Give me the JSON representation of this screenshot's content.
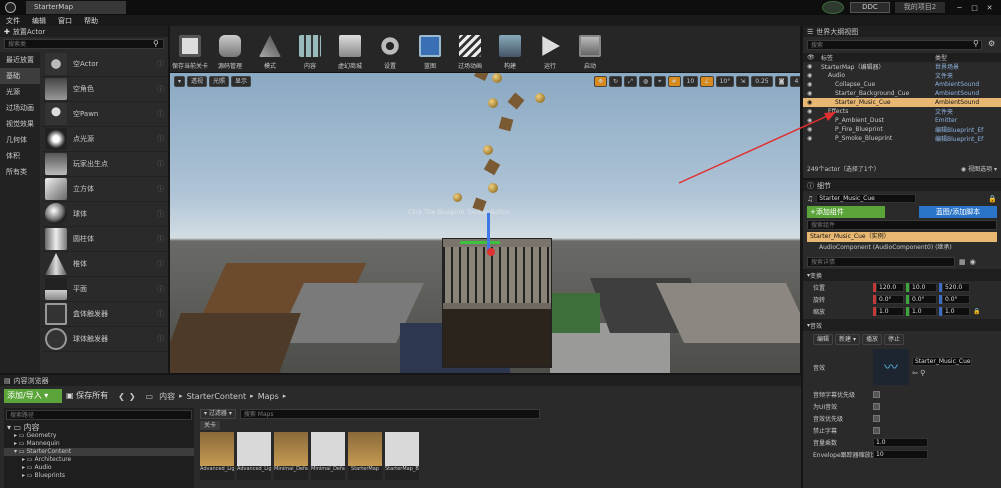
{
  "window": {
    "tab_title": "StarterMap",
    "ddc_label": "DDC",
    "project_name": "我的项目2"
  },
  "menu": [
    "文件",
    "编辑",
    "窗口",
    "帮助"
  ],
  "place_panel": {
    "title": "放置Actor",
    "search_placeholder": "搜索类",
    "categories": [
      "最近放置",
      "基础",
      "光源",
      "过场动画",
      "视觉效果",
      "几何体",
      "体积",
      "所有类"
    ],
    "selected_category": "基础",
    "items": [
      "空Actor",
      "空角色",
      "空Pawn",
      "点光源",
      "玩家出生点",
      "立方体",
      "球体",
      "圆柱体",
      "椎体",
      "平面",
      "盒体触发器",
      "球体触发器"
    ]
  },
  "toolbar": {
    "buttons": [
      "保存当前关卡",
      "源码管理",
      "模式",
      "内容",
      "虚幻商城",
      "设置",
      "蓝图",
      "过场动画",
      "构建",
      "运行",
      "启动"
    ]
  },
  "viewport": {
    "left_buttons": [
      "透视",
      "光照",
      "显示"
    ],
    "grid_snap": "10",
    "rotation_snap": "10°",
    "scale_snap": "0.25",
    "camera_speed": "4",
    "watermark": "Click The Blueprint Toolbar Button"
  },
  "outliner": {
    "title": "世界大纲视图",
    "search_placeholder": "搜索",
    "col_label": "标签",
    "col_type": "类型",
    "rows": [
      {
        "label": "StarterMap（编辑器）",
        "type": "世界场景",
        "indent": 0
      },
      {
        "label": "Audio",
        "type": "文件夹",
        "indent": 1
      },
      {
        "label": "Collapse_Cue",
        "type": "AmbientSound",
        "indent": 2
      },
      {
        "label": "Starter_Background_Cue",
        "type": "AmbientSound",
        "indent": 2
      },
      {
        "label": "Starter_Music_Cue",
        "type": "AmbientSound",
        "indent": 2
      },
      {
        "label": "Effects",
        "type": "文件夹",
        "indent": 1
      },
      {
        "label": "P_Ambient_Dust",
        "type": "Emitter",
        "indent": 2
      },
      {
        "label": "P_Fire_Blueprint",
        "type": "编辑Blueprint_Ef",
        "indent": 2
      },
      {
        "label": "P_Smoke_Blueprint",
        "type": "编辑Blueprint_Ef",
        "indent": 2
      }
    ],
    "selected_row": 4,
    "footer_count": "249个actor（选择了1个）",
    "view_options": "视图选项"
  },
  "details": {
    "title": "细节",
    "name_value": "Starter_Music_Cue",
    "add_component": "+添加组件",
    "blueprint_button": "蓝图/添加脚本",
    "component_search": "搜索组件",
    "root_component": "Starter_Music_Cue（实例）",
    "child_component": "AudioComponent (AudioComponent0) (继承)",
    "detail_search": "搜索详情",
    "transform_section": "变换",
    "location_label": "位置",
    "location": [
      "120.0",
      "10.0",
      "520.0"
    ],
    "rotation_label": "旋转",
    "rotation": [
      "0.0°",
      "0.0°",
      "0.0°"
    ],
    "scale_label": "缩放",
    "scale": [
      "1.0",
      "1.0",
      "1.0"
    ],
    "sound_section": "音效",
    "sound_buttons": [
      "编辑",
      "新建",
      "播放",
      "停止"
    ],
    "sound_label": "音效",
    "sound_asset": "Starter_Music_Cue",
    "props": [
      {
        "label": "音频字幕优先级",
        "kind": "check"
      },
      {
        "label": "为UI音效",
        "kind": "check"
      },
      {
        "label": "音效优先级",
        "kind": "check"
      },
      {
        "label": "禁止字幕",
        "kind": "check"
      },
      {
        "label": "音量乘数",
        "kind": "value",
        "value": "1.0"
      },
      {
        "label": "Envelope跟踪器缩放比",
        "kind": "value",
        "value": "10"
      }
    ]
  },
  "content_browser": {
    "title": "内容浏览器",
    "add_import": "添加/导入",
    "save_all": "保存所有",
    "path": [
      "内容",
      "StarterContent",
      "Maps"
    ],
    "folder_search": "搜索路径",
    "filters": "过滤器",
    "asset_search": "搜索 Maps",
    "tree": [
      "内容",
      "Geometry",
      "Mannequin",
      "StarterContent",
      "Architecture",
      "Audio",
      "Blueprints"
    ],
    "close_button": "关卡",
    "assets": [
      {
        "label": "Advanced_Lighting",
        "kind": "map"
      },
      {
        "label": "Advanced_Lighting_Built",
        "kind": "data"
      },
      {
        "label": "Minimal_Default",
        "kind": "map"
      },
      {
        "label": "Minimal_Default_BuiltData",
        "kind": "data"
      },
      {
        "label": "StarterMap",
        "kind": "map"
      },
      {
        "label": "StarterMap_BuiltData",
        "kind": "data"
      }
    ]
  },
  "colors": {
    "accent_green": "#5ba43a",
    "accent_blue": "#2a75c8",
    "selection": "#e8b872",
    "annotation_arrow": "#e03030"
  }
}
